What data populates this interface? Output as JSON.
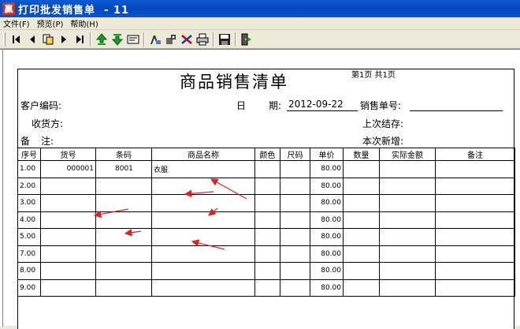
{
  "window": {
    "title": "打印批发销售单  - 11",
    "app_icon_glyph": "贏"
  },
  "menu": {
    "items": [
      "文件(F)",
      "预览(P)",
      "帮助(H)"
    ]
  },
  "toolbar": {
    "buttons": [
      {
        "name": "first-page-icon"
      },
      {
        "name": "prev-page-icon"
      },
      {
        "name": "go-to-page-icon"
      },
      {
        "name": "next-page-icon"
      },
      {
        "name": "last-page-icon"
      },
      {
        "name": "zoom-in-icon"
      },
      {
        "name": "zoom-out-icon"
      },
      {
        "name": "page-setup-icon"
      },
      {
        "name": "text-format-icon"
      },
      {
        "name": "settings-icon"
      },
      {
        "name": "export-icon"
      },
      {
        "name": "print-icon"
      },
      {
        "name": "save-icon"
      },
      {
        "name": "exit-icon"
      }
    ]
  },
  "document": {
    "title": "商品销售清单",
    "page_info": "第1页 共1页",
    "customer_code_label": "客户编码:",
    "date_label_1": "日",
    "date_label_2": "期:",
    "date_value": "2012-09-22",
    "order_no_label": "销售单号:",
    "consignee_label": "收货方:",
    "last_balance_label": "上次结存:",
    "remark_label_1": "备",
    "remark_label_2": "注:",
    "new_added_label": "本次新增:"
  },
  "table": {
    "headers": [
      "序号",
      "货号",
      "条码",
      "商品名称",
      "颜色",
      "尺码",
      "单价",
      "数量",
      "实际金额",
      "备注"
    ],
    "rows": [
      {
        "seq": "1.00",
        "item_no": "000001",
        "barcode": "8001",
        "name": "衣服",
        "price": "80.00"
      },
      {
        "seq": "2.00",
        "item_no": "",
        "barcode": "",
        "name": "",
        "price": "80.00"
      },
      {
        "seq": "3.00",
        "item_no": "",
        "barcode": "",
        "name": "",
        "price": "80.00"
      },
      {
        "seq": "4.00",
        "item_no": "",
        "barcode": "",
        "name": "",
        "price": "80.00"
      },
      {
        "seq": "5.00",
        "item_no": "",
        "barcode": "",
        "name": "",
        "price": "80.00"
      },
      {
        "seq": "7.00",
        "item_no": "",
        "barcode": "",
        "name": "",
        "price": "80.00"
      },
      {
        "seq": "8.00",
        "item_no": "",
        "barcode": "",
        "name": "",
        "price": "80.00"
      },
      {
        "seq": "9.00",
        "item_no": "",
        "barcode": "",
        "name": "",
        "price": "80.00"
      }
    ]
  },
  "colors": {
    "titlebar": "#0a5bd6",
    "annotation_arrow": "#e02020"
  }
}
